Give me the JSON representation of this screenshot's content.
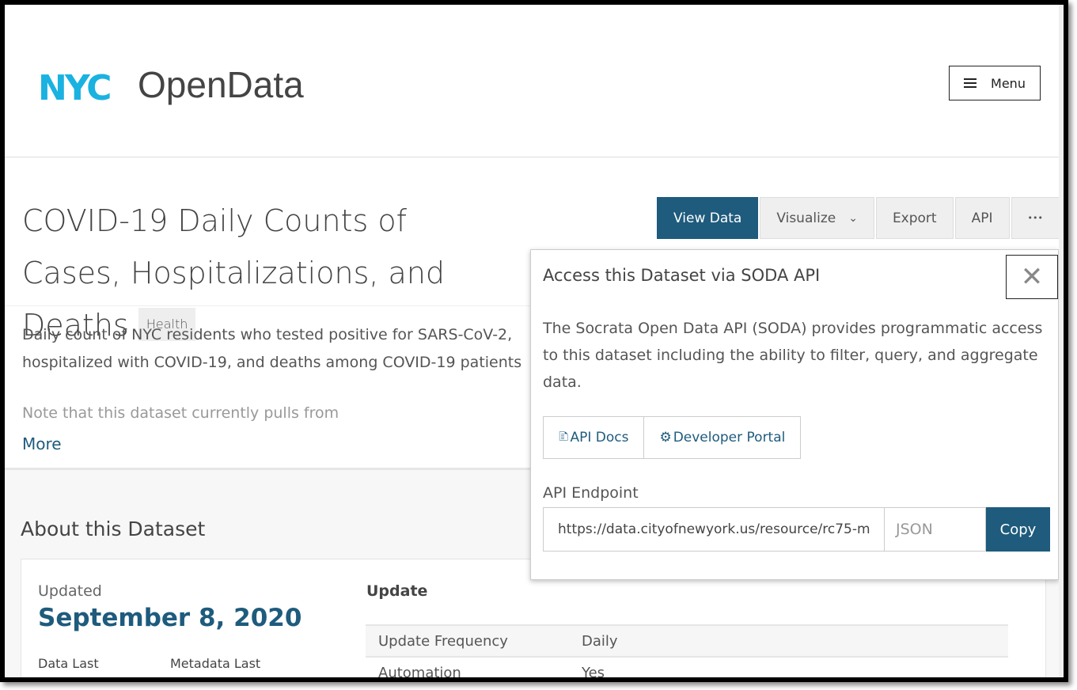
{
  "header": {
    "logo_nyc": "NYC",
    "logo_opendata": "OpenData",
    "menu_label": "Menu"
  },
  "dataset": {
    "title": "COVID-19 Daily Counts of Cases, Hospitalizations, and Deaths",
    "category": "Health",
    "description_lines": [
      "Daily count of NYC residents who tested positive for SARS-CoV-2,",
      "hospitalized with COVID-19, and deaths among COVID-19 patients"
    ],
    "note": "Note that this dataset currently pulls from",
    "more_label": "More"
  },
  "actions": {
    "view_data": "View Data",
    "visualize": "Visualize",
    "export": "Export",
    "api": "API",
    "more": "•••"
  },
  "about": {
    "title": "About this Dataset",
    "updated_label": "Updated",
    "updated_date": "September 8, 2020",
    "data_last": "Data Last",
    "metadata_last": "Metadata Last",
    "update_section": "Update",
    "rows": [
      {
        "label": "Update Frequency",
        "value": "Daily"
      },
      {
        "label": "Automation",
        "value": "Yes"
      }
    ]
  },
  "api_popup": {
    "title": "Access this Dataset via SODA API",
    "text": "The Socrata Open Data API (SODA) provides programmatic access to this dataset including the ability to filter, query, and aggregate data.",
    "api_docs": "API Docs",
    "developer_portal": "Developer Portal",
    "endpoint_label": "API Endpoint",
    "endpoint_value": "https://data.cityofnewyork.us/resource/rc75-m",
    "format": "JSON",
    "copy": "Copy"
  },
  "colors": {
    "brand_blue": "#1ab2e0",
    "primary": "#1e5b7d"
  }
}
